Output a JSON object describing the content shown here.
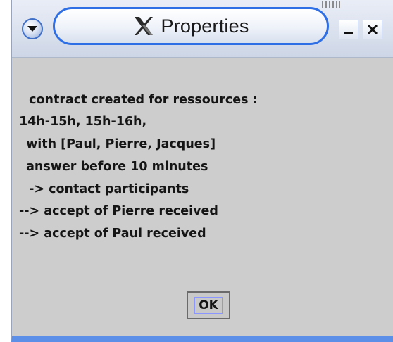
{
  "window": {
    "title": "Properties",
    "title_icon": "x-logo-icon",
    "menu_icon": "chevron-down-icon",
    "minimize_icon": "minimize-icon",
    "close_icon": "close-icon",
    "accent_color": "#2f6fe6",
    "background_color": "#cdcdcd"
  },
  "message": {
    "lines": [
      " contract created for ressources :",
      "14h-15h, 15h-16h,",
      " with [Paul, Pierre, Jacques]",
      " answer before 10 minutes",
      " -> contact participants",
      "--> accept of Pierre received",
      "--> accept of Paul received"
    ]
  },
  "buttons": {
    "ok_label": "OK"
  }
}
